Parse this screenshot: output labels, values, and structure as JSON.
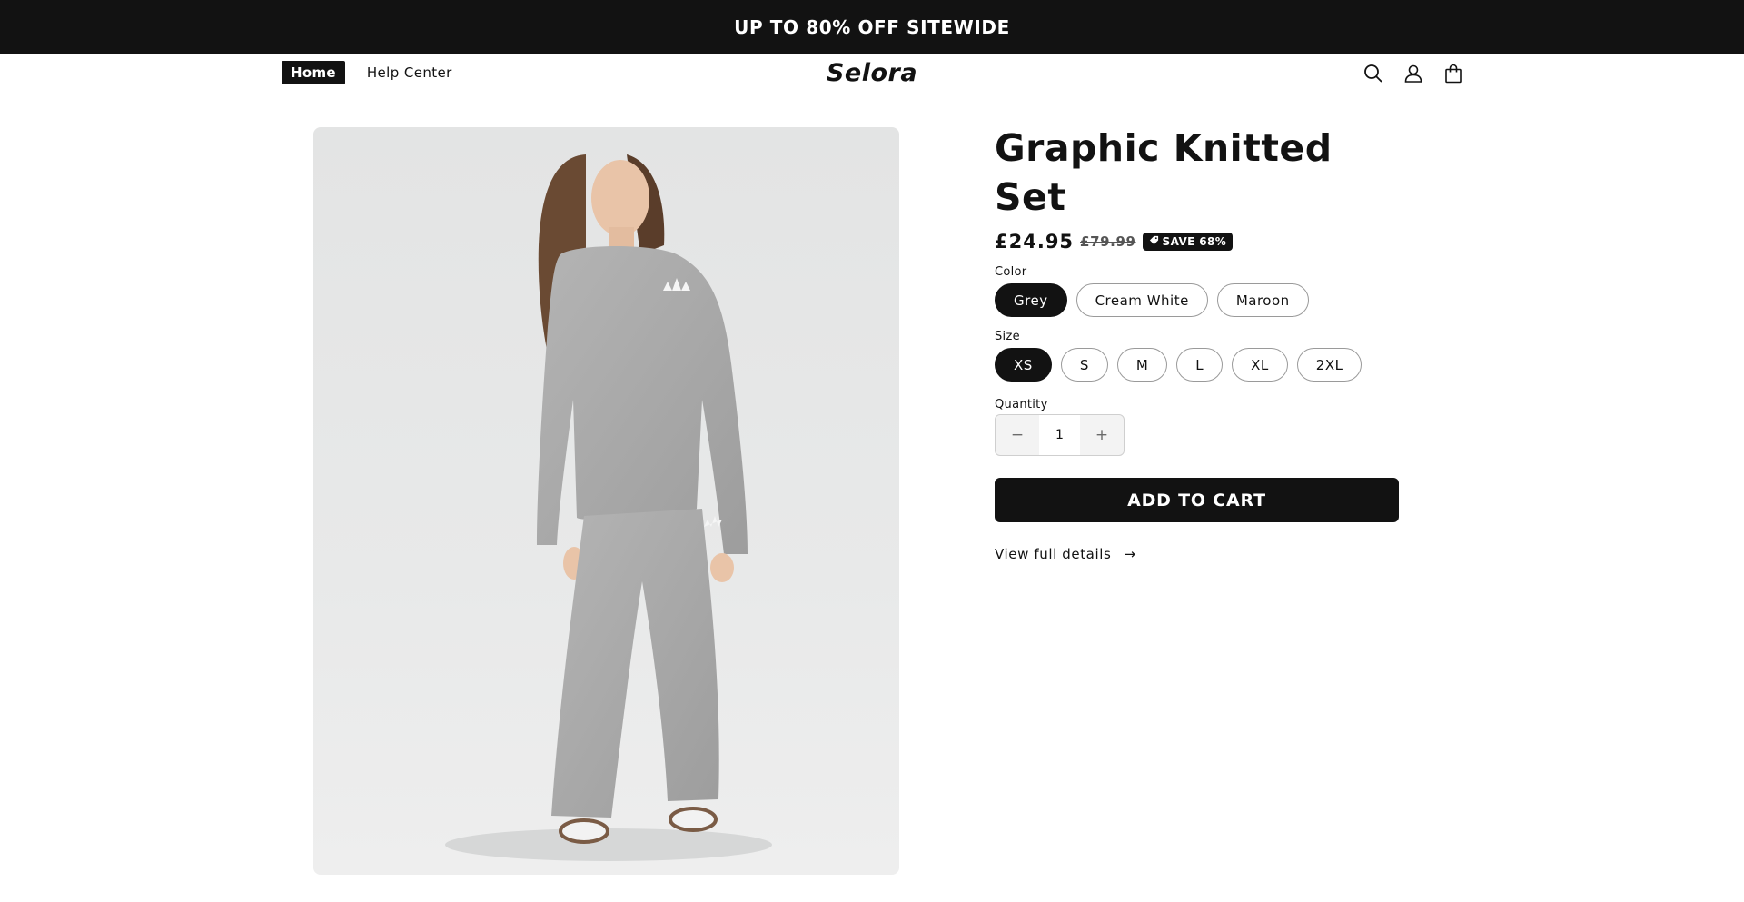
{
  "announcement": {
    "text": "UP TO 80% OFF SITEWIDE"
  },
  "header": {
    "nav": [
      {
        "label": "Home",
        "active": true
      },
      {
        "label": "Help Center",
        "active": false
      }
    ],
    "logo": "Selora",
    "icons": [
      "search-icon",
      "account-icon",
      "cart-icon"
    ]
  },
  "product": {
    "title": "Graphic Knitted Set",
    "price": "£24.95",
    "compare_price": "£79.99",
    "save_badge": "SAVE 68%",
    "color": {
      "label": "Color",
      "selected": "Grey",
      "options": [
        "Grey",
        "Cream White",
        "Maroon"
      ]
    },
    "size": {
      "label": "Size",
      "selected": "XS",
      "options": [
        "XS",
        "S",
        "M",
        "L",
        "XL",
        "2XL"
      ]
    },
    "quantity": {
      "label": "Quantity",
      "value": "1",
      "minus": "−",
      "plus": "+"
    },
    "add_to_cart": "ADD TO CART",
    "details_link": "View full details",
    "details_arrow": "→"
  },
  "colors": {
    "primary": "#121212",
    "background": "#ffffff",
    "image_bg": "#e6e7e7"
  }
}
